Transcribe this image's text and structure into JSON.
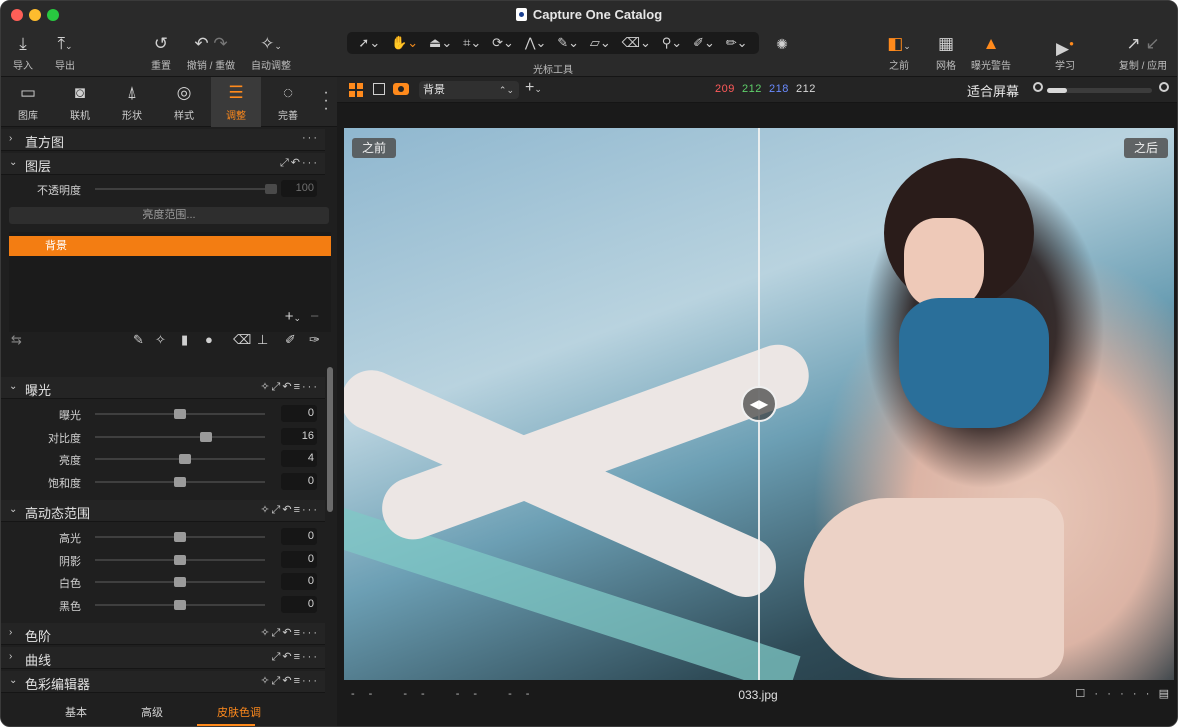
{
  "window": {
    "title": "Capture One Catalog"
  },
  "toolbar": {
    "import_label": "导入",
    "export_label": "导出",
    "reset_label": "重置",
    "undo_redo_label": "撤销 / 重做",
    "auto_adjust_label": "自动调整",
    "cursor_tools_label": "光标工具",
    "before_label": "之前",
    "grid_label": "网格",
    "exposure_warning_label": "曝光警告",
    "learn_label": "学习",
    "copy_apply_label": "复制 / 应用"
  },
  "tool_tabs": [
    {
      "label": "图库",
      "icon": "folder-icon"
    },
    {
      "label": "联机",
      "icon": "camera-icon"
    },
    {
      "label": "形状",
      "icon": "shape-icon"
    },
    {
      "label": "样式",
      "icon": "style-icon"
    },
    {
      "label": "调整",
      "icon": "sliders-icon",
      "active": true
    },
    {
      "label": "完善",
      "icon": "refine-icon"
    }
  ],
  "panels": {
    "histogram": {
      "title": "直方图"
    },
    "layers": {
      "title": "图层",
      "opacity_label": "不透明度",
      "opacity_value": "100",
      "luma_range_label": "亮度范围...",
      "layer_name": "背景"
    },
    "exposure": {
      "title": "曝光",
      "rows": [
        {
          "label": "曝光",
          "value": "0",
          "pos": 0.5
        },
        {
          "label": "对比度",
          "value": "16",
          "pos": 0.65
        },
        {
          "label": "亮度",
          "value": "4",
          "pos": 0.53
        },
        {
          "label": "饱和度",
          "value": "0",
          "pos": 0.5
        }
      ]
    },
    "hdr": {
      "title": "高动态范围",
      "rows": [
        {
          "label": "高光",
          "value": "0",
          "pos": 0.5
        },
        {
          "label": "阴影",
          "value": "0",
          "pos": 0.5
        },
        {
          "label": "白色",
          "value": "0",
          "pos": 0.5
        },
        {
          "label": "黑色",
          "value": "0",
          "pos": 0.5
        }
      ]
    },
    "levels": {
      "title": "色阶"
    },
    "curves": {
      "title": "曲线"
    },
    "color_editor": {
      "title": "色彩编辑器",
      "tabs": [
        "基本",
        "高级",
        "皮肤色调"
      ],
      "active_tab": "皮肤色调"
    }
  },
  "viewer": {
    "layer_select": "背景",
    "rgb": {
      "r": "209",
      "g": "212",
      "b": "218",
      "l": "212"
    },
    "fit_label": "适合屏幕",
    "zoom_fraction": 0.19,
    "before_tag": "之前",
    "after_tag": "之后",
    "file_name": "033.jpg",
    "meta_dashes": "-- -- -- --"
  },
  "colors": {
    "accent": "#ff8a1c",
    "layer_bg": "#f37d12"
  }
}
